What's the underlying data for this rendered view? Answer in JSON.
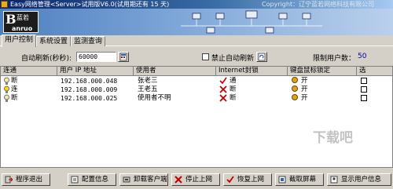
{
  "window": {
    "title": "Easy网络管理<Server>试用版V6.0(试用期还有 15 天)",
    "copyright": "Copyright：辽宁蓝若网络科技有限公司"
  },
  "logo": {
    "line1": "B",
    "line2": "蓝若",
    "line3": "anruo"
  },
  "tabs": [
    "用户控制",
    "系统设置",
    "监测查询"
  ],
  "controls": {
    "refresh_label": "自动刷新(秒秒):",
    "refresh_value": "60000",
    "disable_refresh_label": "禁止自动刷新",
    "user_limit_label": "限制用户数：",
    "user_limit_value": "50"
  },
  "table": {
    "headers": [
      "连通",
      "用户 IP 地址",
      "使用者",
      "Internet封锁",
      "键盘鼠标锁定",
      "选"
    ],
    "rows": [
      {
        "status": "断",
        "ip": "192.168.000.048",
        "user": "张老三",
        "internet": "通",
        "keyboard": "开"
      },
      {
        "status": "连",
        "ip": "192.168.000.009",
        "user": "王老五",
        "internet": "断",
        "keyboard": "开"
      },
      {
        "status": "断",
        "ip": "192.168.000.025",
        "user": "使用者不明",
        "internet": "断",
        "keyboard": "开"
      }
    ]
  },
  "toolbar": [
    {
      "label": "程序退出",
      "icon": "exit-icon"
    },
    {
      "label": "配置信息",
      "icon": "config-icon"
    },
    {
      "label": "卸载客户端",
      "icon": "uninstall-icon"
    },
    {
      "label": "停止上网",
      "icon": "stop-icon"
    },
    {
      "label": "恢复上网",
      "icon": "check-icon"
    },
    {
      "label": "截取屏幕",
      "icon": "screenshot-icon"
    },
    {
      "label": "显示用户信息",
      "icon": "user-info-icon"
    }
  ],
  "watermark": "下载吧",
  "colors": {
    "titlebar": "#0a246a",
    "banner": "#7ea6d8",
    "accent_red": "#c00000",
    "window_bg": "#d4d0c8"
  }
}
